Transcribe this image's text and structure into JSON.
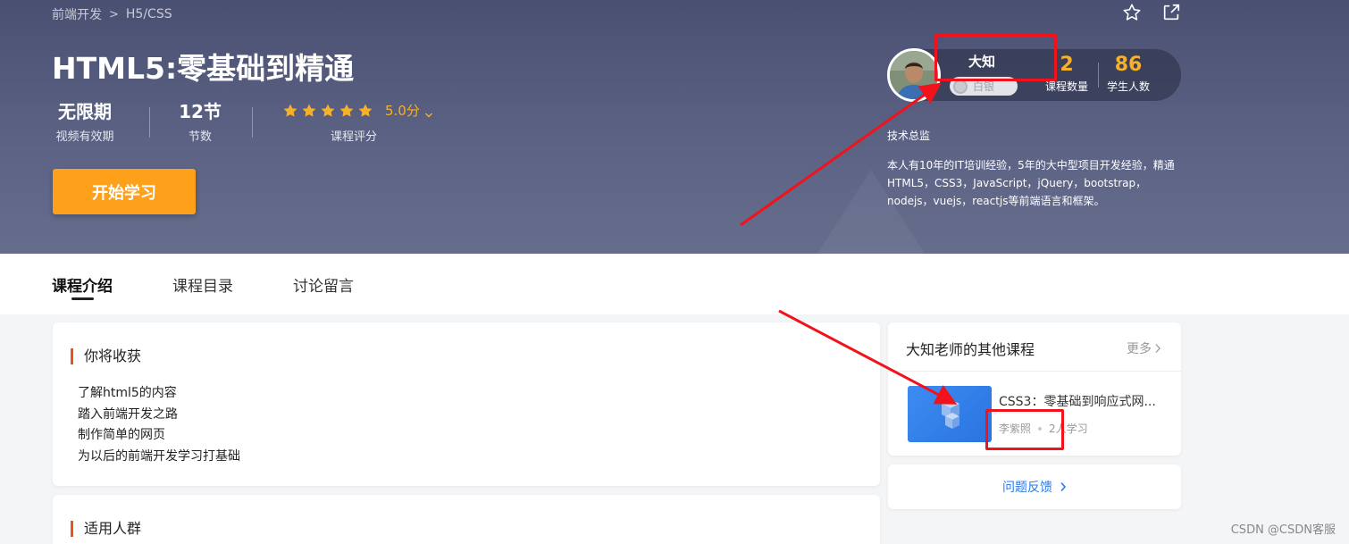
{
  "breadcrumb": {
    "level1": "前端开发",
    "separator": ">",
    "level2": "H5/CSS"
  },
  "course": {
    "title": "HTML5:零基础到精通",
    "validity_value": "无限期",
    "validity_label": "视频有效期",
    "sections_value": "12节",
    "sections_label": "节数",
    "rating_score": "5.0分",
    "rating_label": "课程评分",
    "rating_stars": 5,
    "start_button": "开始学习"
  },
  "teacher": {
    "name": "大知",
    "level": "白银",
    "course_count": "2",
    "course_count_label": "课程数量",
    "student_count": "86",
    "student_count_label": "学生人数",
    "job": "技术总监",
    "bio": "本人有10年的IT培训经验，5年的大中型项目开发经验，精通HTML5，CSS3，JavaScript，jQuery，bootstrap，nodejs，vuejs，reactjs等前端语言和框架。"
  },
  "tabs": [
    "课程介绍",
    "课程目录",
    "讨论留言"
  ],
  "gain": {
    "heading": "你将收获",
    "items": [
      "了解html5的内容",
      "踏入前端开发之路",
      "制作简单的网页",
      "为以后的前端开发学习打基础"
    ]
  },
  "audience": {
    "heading": "适用人群"
  },
  "other_courses": {
    "heading": "大知老师的其他课程",
    "more": "更多",
    "item": {
      "title": "CSS3：零基础到响应式网...",
      "author": "李紫照",
      "students": "2人学习"
    }
  },
  "feedback": {
    "label": "问题反馈"
  },
  "watermark": "CSDN @CSDN客服",
  "colors": {
    "accent_orange": "#fea01a",
    "star": "#f6b128",
    "link_blue": "#2b7be5",
    "annotation_red": "#f2121b",
    "heading_bar": "#e9531d"
  }
}
